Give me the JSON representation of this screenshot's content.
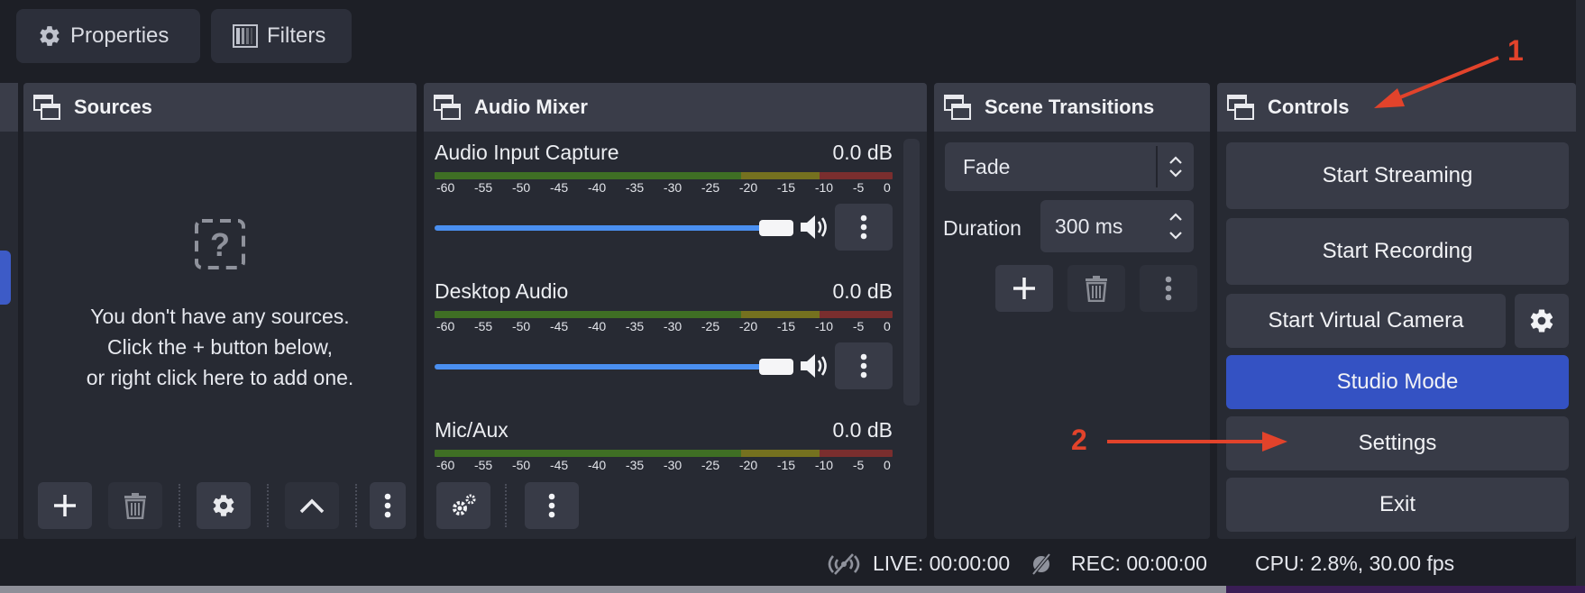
{
  "toolbar": {
    "properties_label": "Properties",
    "filters_label": "Filters"
  },
  "sources": {
    "title": "Sources",
    "empty_line1": "You don't have any sources.",
    "empty_line2": "Click the + button below,",
    "empty_line3": "or right click here to add one."
  },
  "audio_mixer": {
    "title": "Audio Mixer",
    "ticks": [
      "-60",
      "-55",
      "-50",
      "-45",
      "-40",
      "-35",
      "-30",
      "-25",
      "-20",
      "-15",
      "-10",
      "-5",
      "0"
    ],
    "channels": [
      {
        "name": "Audio Input Capture",
        "level": "0.0 dB"
      },
      {
        "name": "Desktop Audio",
        "level": "0.0 dB"
      },
      {
        "name": "Mic/Aux",
        "level": "0.0 dB"
      }
    ]
  },
  "transitions": {
    "title": "Scene Transitions",
    "selected": "Fade",
    "duration_label": "Duration",
    "duration_value": "300 ms"
  },
  "controls": {
    "title": "Controls",
    "start_streaming": "Start Streaming",
    "start_recording": "Start Recording",
    "start_virtual_camera": "Start Virtual Camera",
    "studio_mode": "Studio Mode",
    "settings": "Settings",
    "exit": "Exit"
  },
  "status": {
    "live": "LIVE: 00:00:00",
    "rec": "REC: 00:00:00",
    "cpu": "CPU: 2.8%, 30.00 fps"
  },
  "annotations": {
    "one": "1",
    "two": "2"
  },
  "colors": {
    "accent": "#3452c3",
    "annotation": "#e2432b",
    "fader": "#4a8ff0"
  }
}
